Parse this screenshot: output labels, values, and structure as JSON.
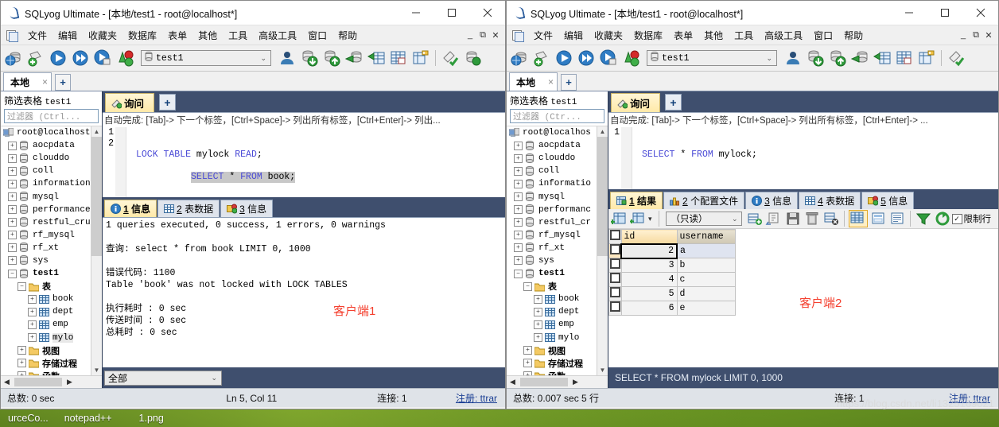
{
  "window_left": {
    "title": "SQLyog Ultimate - [本地/test1 - root@localhost*]",
    "title_icon": "sqlyog-icon",
    "controls": {
      "minimize": "minimize-icon",
      "maximize": "maximize-icon",
      "close": "close-icon"
    },
    "menu": [
      "文件",
      "编辑",
      "收藏夹",
      "数据库",
      "表单",
      "其他",
      "工具",
      "高级工具",
      "窗口",
      "帮助"
    ],
    "mdi_buttons": [
      "_",
      "⧉",
      "✕"
    ],
    "toolbar": {
      "db_selector": "test1",
      "icons": [
        "connect-icon",
        "new-connection-icon",
        "execute-icon",
        "execute-all-icon",
        "execute-current-icon",
        "refresh-objects-icon",
        "user-manager-icon",
        "import-data-icon",
        "export-data-icon",
        "backup-db-icon",
        "export-table-icon",
        "table-data-icon",
        "schema-designer-icon",
        "syntax-check-icon",
        "restore-icon"
      ]
    },
    "connection_tabs": {
      "active": "本地",
      "close": "×",
      "add": "+"
    },
    "object_pane": {
      "filter_label": "筛选表格",
      "filter_db": "test1",
      "filter_placeholder": "过滤器 (Ctrl...",
      "root": "root@localhost",
      "databases": [
        "aocpdata",
        "clouddo",
        "coll",
        "information",
        "mysql",
        "performance",
        "restful_cru",
        "rf_mysql",
        "rf_xt",
        "sys"
      ],
      "current_db": "test1",
      "folders": {
        "tables": "表",
        "views": "视图",
        "procedures": "存储过程",
        "functions": "函数"
      },
      "tables": [
        "book",
        "dept",
        "emp",
        "mylo"
      ],
      "selected_table": "mylo"
    },
    "query_tab": {
      "label": "询问",
      "add": "+"
    },
    "autocomplete_hint": "自动完成: [Tab]-> 下一个标签，[Ctrl+Space]-> 列出所有标签，[Ctrl+Enter]-> 列出...",
    "editor": {
      "lines": [
        {
          "no": "1",
          "kw1": "LOCK TABLE",
          "mid": " mylock ",
          "kw2": "READ",
          "tail": ";"
        },
        {
          "no": "2",
          "kw1": "SELECT",
          "mid": " * ",
          "kw2": "FROM",
          "tail": " book;"
        }
      ],
      "line1_full": "LOCK TABLE mylock READ;",
      "line2_full": "SELECT * FROM book;"
    },
    "result_tabs": [
      {
        "num": "1",
        "label": "信息",
        "icon": "info-icon",
        "active": true
      },
      {
        "num": "2",
        "label": "表数据",
        "icon": "table-data-icon",
        "active": false
      },
      {
        "num": "3",
        "label": "信息",
        "icon": "messages-icon",
        "active": false
      }
    ],
    "messages": [
      "1 queries executed, 0 success, 1 errors, 0 warnings",
      "",
      "查询: select * from book LIMIT 0, 1000",
      "",
      "错误代码:  1100",
      "Table 'book' was not locked with LOCK TABLES",
      "",
      "执行耗时   : 0 sec",
      "传送时间   : 0 sec",
      "总耗时     : 0 sec"
    ],
    "annotation": "客户端1",
    "bottom_combo": "全部",
    "statusbar": {
      "total": "总数: 0 sec",
      "caret": "Ln 5, Col 11",
      "connections": "连接: 1",
      "register": "注册: ttrar"
    }
  },
  "window_right": {
    "title": "SQLyog Ultimate - [本地/test1 - root@localhost*]",
    "title_icon": "sqlyog-icon",
    "controls": {
      "minimize": "minimize-icon",
      "maximize": "maximize-icon",
      "close": "close-icon"
    },
    "menu": [
      "文件",
      "编辑",
      "收藏夹",
      "数据库",
      "表单",
      "其他",
      "工具",
      "高级工具",
      "窗口",
      "帮助"
    ],
    "mdi_buttons": [
      "_",
      "⧉",
      "✕"
    ],
    "toolbar": {
      "db_selector": "test1"
    },
    "connection_tabs": {
      "active": "本地",
      "close": "×",
      "add": "+"
    },
    "object_pane": {
      "filter_label": "筛选表格",
      "filter_db": "test1",
      "filter_placeholder": "过滤器 (Ctr...",
      "root": "root@localhos",
      "databases": [
        "aocpdata",
        "clouddo",
        "coll",
        "informatio",
        "mysql",
        "performanc",
        "restful_cr",
        "rf_mysql",
        "rf_xt",
        "sys"
      ],
      "current_db": "test1",
      "folders": {
        "tables": "表",
        "views": "视图",
        "procedures": "存储过程",
        "functions": "函数"
      },
      "tables": [
        "book",
        "dept",
        "emp",
        "mylo"
      ]
    },
    "query_tab": {
      "label": "询问",
      "add": "+"
    },
    "autocomplete_hint": "自动完成: [Tab]-> 下一个标签，[Ctrl+Space]-> 列出所有标签，[Ctrl+Enter]-> ...",
    "editor": {
      "lines": [
        {
          "no": "1",
          "kw1": "SELECT",
          "mid": " * ",
          "kw2": "FROM",
          "tail": " mylock;"
        }
      ],
      "line1_full": "SELECT * FROM mylock;"
    },
    "result_tabs": [
      {
        "num": "1",
        "label": "结果",
        "icon": "result-grid-icon",
        "active": true
      },
      {
        "num": "2",
        "label": "个配置文件",
        "icon": "profile-icon",
        "active": false
      },
      {
        "num": "3",
        "label": "信息",
        "icon": "info-icon",
        "active": false
      },
      {
        "num": "4",
        "label": "表数据",
        "icon": "table-data-icon",
        "active": false
      },
      {
        "num": "5",
        "label": "信息",
        "icon": "messages-icon",
        "active": false
      }
    ],
    "grid_toolbar": {
      "mode": "（只读）",
      "limit_label": "限制行",
      "limit_checked": true,
      "icons": [
        "grid-insert-icon",
        "grid-duplicate-icon",
        "add-row-icon",
        "copy-row-icon",
        "save-icon",
        "delete-row-icon",
        "cancel-edit-icon",
        "grid-view-icon",
        "form-view-icon",
        "text-view-icon",
        "filter-icon",
        "refresh-icon"
      ]
    },
    "grid": {
      "columns": [
        "id",
        "username"
      ],
      "rows": [
        {
          "id": "2",
          "username": "a"
        },
        {
          "id": "3",
          "username": "b"
        },
        {
          "id": "4",
          "username": "c"
        },
        {
          "id": "5",
          "username": "d"
        },
        {
          "id": "6",
          "username": "e"
        }
      ]
    },
    "annotation": "客户端2",
    "sql_status": "SELECT * FROM mylock LIMIT 0, 1000",
    "statusbar": {
      "total": "总数: 0.007 sec 5 行",
      "connections": "连接: 1",
      "register": "注册: ttrar"
    }
  },
  "taskbar": {
    "items": [
      "urceCo...",
      "notepad++",
      "1.png"
    ]
  },
  "watermark": "https://blog.csdn.net/li1325169021"
}
